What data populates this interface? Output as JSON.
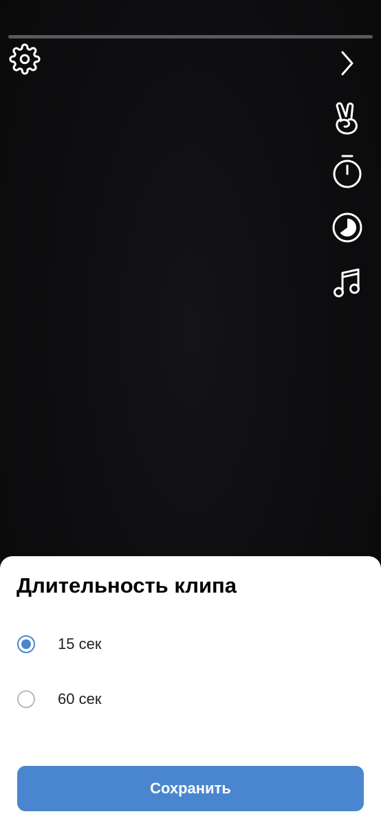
{
  "camera": {
    "recording_progress": 0,
    "icons": [
      "settings-icon",
      "chevron-right-icon",
      "gesture-icon",
      "timer-icon",
      "speed-icon",
      "music-icon"
    ]
  },
  "sheet": {
    "title": "Длительность клипа",
    "options": [
      {
        "label": "15 сек",
        "selected": true
      },
      {
        "label": "60 сек",
        "selected": false
      }
    ],
    "save_label": "Сохранить"
  },
  "colors": {
    "accent": "#4a86cf",
    "background": "#0b0b0c",
    "sheet": "#ffffff",
    "radio_inactive": "#b7babd"
  }
}
